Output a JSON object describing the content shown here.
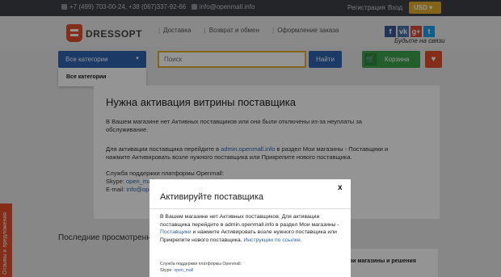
{
  "topbar": {
    "phones": "+7 (499) 703-00-24, +38 (067)337-92-66",
    "email": "info@openmall.info",
    "register": "Регистрация",
    "login": "Вход",
    "currency": "USD"
  },
  "header": {
    "logo_text": "DRESSOPT",
    "nav": [
      "Доставка",
      "Возврат и обмен",
      "Оформление заказа"
    ],
    "social": [
      {
        "icon": "facebook-icon",
        "glyph": "f",
        "color": "#3b5998"
      },
      {
        "icon": "vk-icon",
        "glyph": "vk",
        "color": "#4a76a8"
      },
      {
        "icon": "google-plus-icon",
        "glyph": "g+",
        "color": "#dd4b39"
      },
      {
        "icon": "twitter-icon",
        "glyph": "t",
        "color": "#1da1f2"
      }
    ],
    "tagline": "Будьте на связи"
  },
  "search": {
    "category_label": "Все категории",
    "placeholder": "Поиск",
    "button": "Найти",
    "cart": "Корзина",
    "dropdown_item": "Все категории"
  },
  "content": {
    "title": "Нужна активация витрины поставщика",
    "p1": "В Вашем магазине нет Активных поставщиков или они были отключены из-за неуплаты за обслуживание.",
    "p2_before": "Для активации поставщика перейдите в ",
    "p2_link": "admin.openmall.info",
    "p2_after": " в раздел Мои магазины - Поставщики и нажмите Активировать возле нужного поставщика или Прикрепите нового поставщика.",
    "support": "Служба поддержки платформы Openmall:",
    "skype_label": "Skype: ",
    "skype": "open_mall",
    "email_label": "E-mail: ",
    "email": "info@openmall.info"
  },
  "recent_title": "Последние просмотренные",
  "right_card": "Мои магазины и решения",
  "side_tab": "Отзывы и предложения",
  "modal": {
    "close": "x",
    "title": "Активируйте поставщика",
    "body_1": "В Вашем магазине нет Активных поставщиков. Для активации поставщика перейдите в admin.openmall.info в раздел Мои магазины - ",
    "body_link1": "Поставщики",
    "body_2": " и нажмите Активировать возле нужного поставщика или Прикрепите нового поставщика. ",
    "body_link2": "Инструкции по ссылке.",
    "support": "Служба поддержки платформы Openmall:",
    "skype_label": "Skype: ",
    "skype": "open_mall"
  }
}
